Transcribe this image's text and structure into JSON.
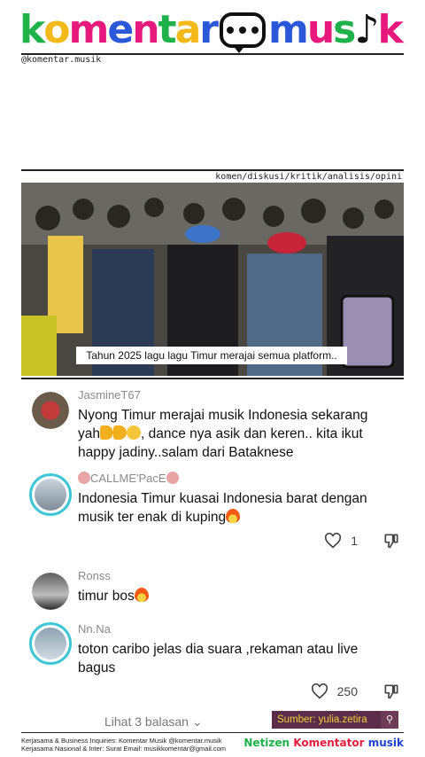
{
  "header": {
    "brand_part1": "komentar",
    "brand_part2": "mus",
    "brand_part3": "k",
    "handle": "@komentar.musik",
    "tags": "komen/diskusi/kritik/analisis/opini"
  },
  "video": {
    "caption": "Tahun 2025 lagu lagu Timur merajai semua platform.."
  },
  "comments": [
    {
      "username": "JasmineT67",
      "text_a": "Nyong Timur merajai musik Indonesia sekarang",
      "text_b": "yah",
      "text_c": ", dance nya asik dan keren.. kita ikut",
      "text_d": "happy jadiny..salam dari Bataknese"
    },
    {
      "username": "CALLME'PacE",
      "text_a": "Indonesia Timur kuasai Indonesia barat dengan",
      "text_b": "musik ter enak di kuping",
      "likes": "1"
    },
    {
      "username": "Ronss",
      "text_a": "timur bos"
    },
    {
      "username": "Nn.Na",
      "text_a": "toton caribo jelas dia suara ,rekaman atau live",
      "text_b": "bagus",
      "likes": "250"
    }
  ],
  "replies_label": "Lihat 3 balasan",
  "source": "Sumber: yulia.zetira",
  "footer": {
    "line1": "Kerjasama & Business Inquiries: Komentar Musik @komentar.musik",
    "line2": "Kerjasama Nasional & Inter: Surat Email: musikkomentar@gmail.com",
    "brand_a": "Netizen ",
    "brand_b": "Komentator ",
    "brand_c": "musik"
  },
  "colors": {
    "accent_ring": "#3fc6d6",
    "source_bg": "#5b2d4a",
    "source_text": "#f3d038"
  }
}
